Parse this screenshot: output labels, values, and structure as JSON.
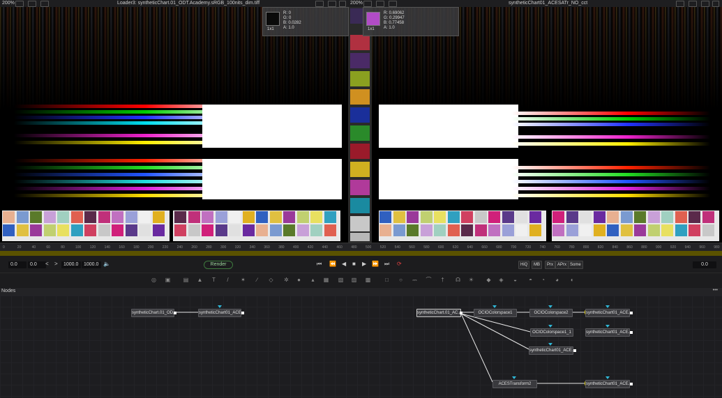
{
  "left_viewer": {
    "zoom": "200%",
    "title": "Loader3: syntheticChart.01_ODT.Academy.sRGB_100nits_dim.tiff"
  },
  "right_viewer": {
    "zoom": "200%",
    "title": "syntheticChart01_ACESATr_NO_cct"
  },
  "pickers": [
    {
      "swatch": "#0a0a0a",
      "r": "R: 0",
      "g": "G: 0",
      "b": "B: 0.0282",
      "a": "A: 1.0",
      "size": "1x1"
    },
    {
      "swatch": "#b14cc6",
      "r": "R: 0.69062",
      "g": "G: 0.29947",
      "b": "B: 0.77458",
      "a": "A: 1.0",
      "size": "1x1"
    }
  ],
  "ruler_ticks": [
    "0",
    "20",
    "40",
    "60",
    "80",
    "100",
    "120",
    "140",
    "160",
    "180",
    "200",
    "220",
    "240",
    "260",
    "280",
    "300",
    "320",
    "340",
    "360",
    "380",
    "400",
    "420",
    "440",
    "460",
    "480",
    "500",
    "520",
    "540",
    "560",
    "580",
    "600",
    "620",
    "640",
    "660",
    "680",
    "700",
    "720",
    "740",
    "760",
    "780",
    "800",
    "820",
    "840",
    "860",
    "880",
    "900",
    "920",
    "940",
    "960",
    "980"
  ],
  "transport": {
    "start": "0.0",
    "current": "0.0",
    "end1": "1000.0",
    "end2": "1000.0",
    "render": "Render",
    "buttons": [
      "HiQ",
      "MB",
      "Prx",
      "APrx",
      "Some"
    ],
    "frame": "0.0"
  },
  "nodes_panel": {
    "title": "Nodes",
    "more": "•••"
  },
  "nodes": {
    "n1": "syntheticChart.01_OD...",
    "n2": "syntheticChart01_ACE...",
    "n3": "syntheticChart.01_AC...",
    "n4": "OCIOColorspace1",
    "n5": "OCIOColorspace2",
    "n6": "syntheticChart01_ACE...",
    "n7": "OCIOColorspace1_1",
    "n8": "syntheticChart01_ACE...",
    "n9": "syntheticChart01_ACE...",
    "n10": "ACESTransform2",
    "n11": "syntheticChart01_ACE..."
  },
  "colors": {
    "accent_timeline": "#5a5200",
    "render_green": "#9cd69c",
    "node_cyan": "#2fb7d6"
  }
}
